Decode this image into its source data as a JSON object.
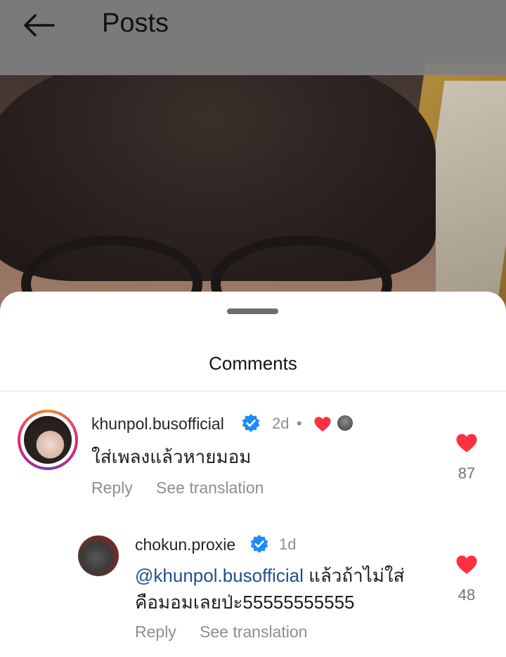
{
  "header": {
    "title": "Posts"
  },
  "sheet": {
    "title": "Comments"
  },
  "comments": [
    {
      "username": "khunpol.busofficial",
      "time": "2d",
      "dot": "•",
      "text": "ใส่เพลงแล้วหายมอม",
      "reply_label": "Reply",
      "translate_label": "See translation",
      "likes": "87"
    },
    {
      "username": "chokun.proxie",
      "time": "1d",
      "mention": "@khunpol.busofficial",
      "text_line1": " แล้วถ้าไม่ใส่",
      "text_line2": "คือมอมเลยป่ะ55555555555",
      "reply_label": "Reply",
      "translate_label": "See translation",
      "likes": "48"
    }
  ],
  "colors": {
    "heart": "#ff3040",
    "verified": "#1a8cff",
    "header_bg": "#808080"
  }
}
